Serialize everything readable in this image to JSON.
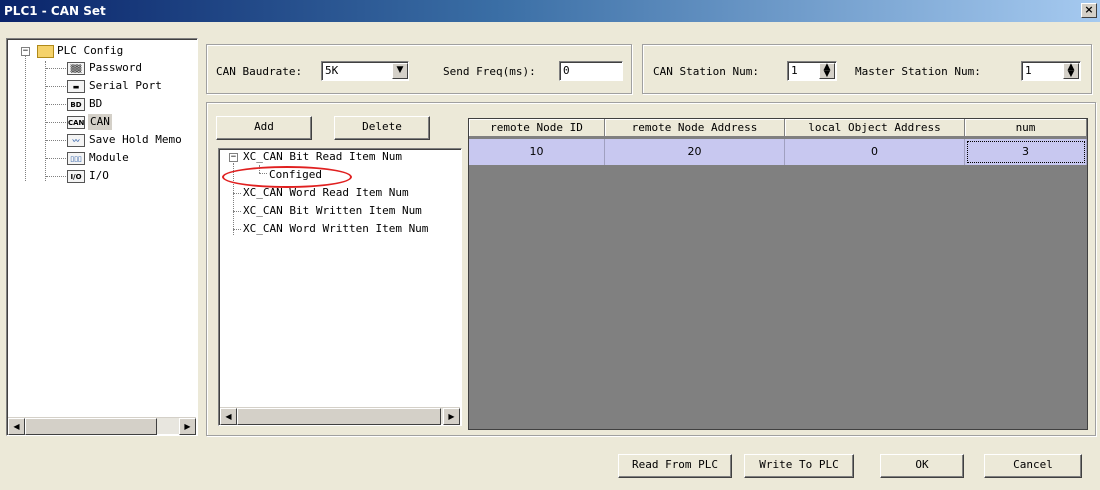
{
  "window": {
    "title": "PLC1 - CAN Set",
    "close_label": "×"
  },
  "left_tree": {
    "root": "PLC Config",
    "items": [
      {
        "icon": "password-icon",
        "icon_text": "▒▒",
        "label": "Password"
      },
      {
        "icon": "serial-port-icon",
        "icon_text": "▬",
        "label": "Serial Port"
      },
      {
        "icon": "bd-icon",
        "icon_text": "BD",
        "label": "BD"
      },
      {
        "icon": "can-icon",
        "icon_text": "CAN",
        "label": "CAN"
      },
      {
        "icon": "waveform-icon",
        "icon_text": "〰",
        "label": "Save Hold Memo"
      },
      {
        "icon": "module-icon",
        "icon_text": "▯▯▯",
        "label": "Module"
      },
      {
        "icon": "io-icon",
        "icon_text": "I/O",
        "label": "I/O"
      }
    ]
  },
  "settings": {
    "baud_label": "CAN Baudrate:",
    "baud_value": "5K",
    "freq_label": "Send Freq(ms):",
    "freq_value": "0",
    "station_label": "CAN Station Num:",
    "station_value": "1",
    "master_label": "Master Station Num:",
    "master_value": "1"
  },
  "buttons": {
    "add": "Add",
    "delete": "Delete",
    "read_plc": "Read From PLC",
    "write_plc": "Write To PLC",
    "ok": "OK",
    "cancel": "Cancel"
  },
  "inner_tree": {
    "items": [
      {
        "label": "XC_CAN Bit Read Item Num",
        "expanded": true
      },
      {
        "label": "Configed",
        "child": true
      },
      {
        "label": "XC_CAN Word Read Item Num"
      },
      {
        "label": "XC_CAN Bit Written Item Num"
      },
      {
        "label": "XC_CAN Word Written Item Num"
      }
    ]
  },
  "grid": {
    "headers": [
      "remote Node ID",
      "remote Node Address",
      "local Object Address",
      "num"
    ],
    "rows": [
      [
        "10",
        "20",
        "0",
        "3"
      ]
    ]
  },
  "colors": {
    "row_highlight": "#c8c8f0",
    "annotation": "#e02020"
  }
}
